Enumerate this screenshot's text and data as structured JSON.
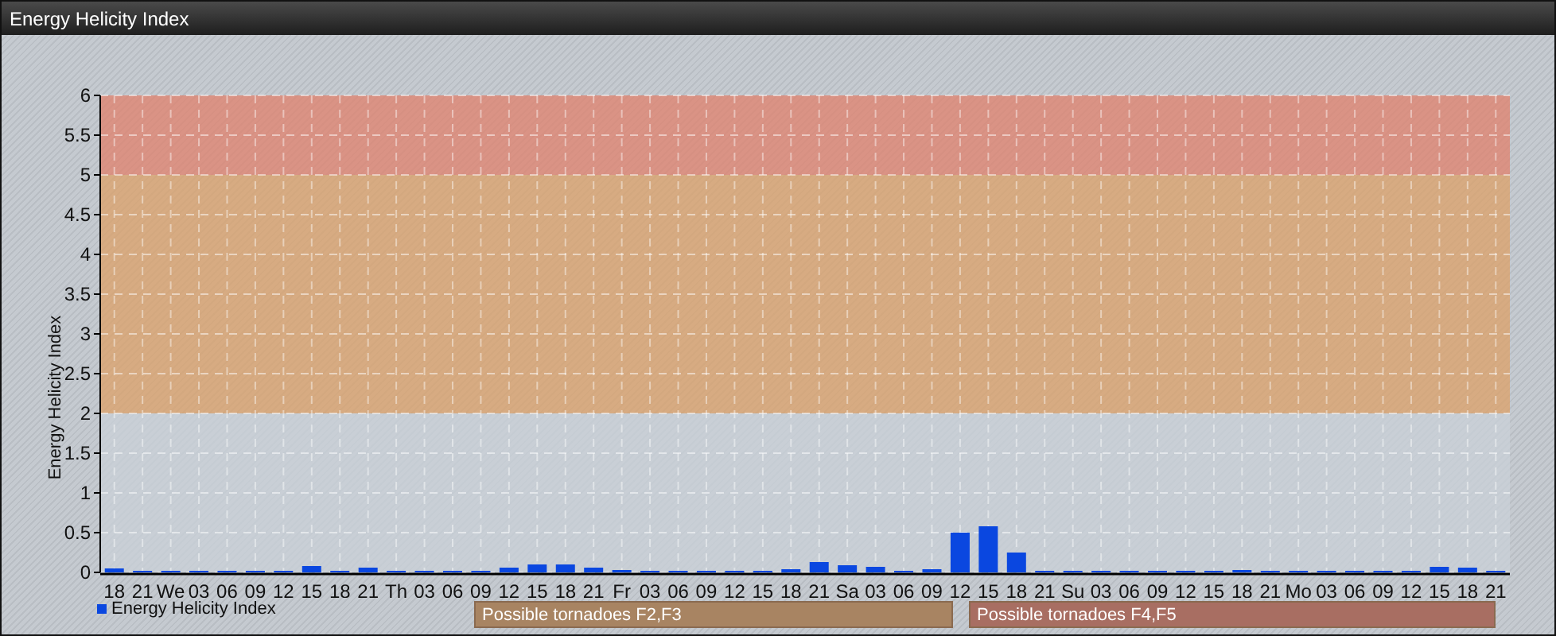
{
  "window": {
    "title": "Energy Helicity Index"
  },
  "chart": {
    "chart_data": {
      "type": "bar",
      "ylabel": "Energy Helicity Index",
      "categories": [
        "18",
        "21",
        "We",
        "03",
        "06",
        "09",
        "12",
        "15",
        "18",
        "21",
        "Th",
        "03",
        "06",
        "09",
        "12",
        "15",
        "18",
        "21",
        "Fr",
        "03",
        "06",
        "09",
        "12",
        "15",
        "18",
        "21",
        "Sa",
        "03",
        "06",
        "09",
        "12",
        "15",
        "18",
        "21",
        "Su",
        "03",
        "06",
        "09",
        "12",
        "15",
        "18",
        "21",
        "Mo",
        "03",
        "06",
        "09",
        "12",
        "15",
        "18",
        "21"
      ],
      "series": [
        {
          "name": "Energy Helicity Index",
          "color": "#0a47e0",
          "values": [
            0.05,
            0.02,
            0.02,
            0.02,
            0.02,
            0.02,
            0.02,
            0.08,
            0.02,
            0.06,
            0.02,
            0.02,
            0.02,
            0.02,
            0.06,
            0.1,
            0.1,
            0.06,
            0.03,
            0.02,
            0.02,
            0.02,
            0.02,
            0.02,
            0.04,
            0.13,
            0.09,
            0.07,
            0.02,
            0.04,
            0.5,
            0.58,
            0.25,
            0.02,
            0.02,
            0.02,
            0.02,
            0.02,
            0.02,
            0.02,
            0.03,
            0.02,
            0.02,
            0.02,
            0.02,
            0.02,
            0.02,
            0.07,
            0.06,
            0.02
          ]
        }
      ],
      "ylim": [
        0,
        6
      ],
      "yticks": [
        0,
        0.5,
        1,
        1.5,
        2,
        2.5,
        3,
        3.5,
        4,
        4.5,
        5,
        5.5,
        6
      ],
      "grid": true,
      "bands": [
        {
          "axis": "y",
          "from": 0,
          "to": 2,
          "color": "#c9d0d8"
        },
        {
          "axis": "y",
          "from": 2,
          "to": 5,
          "color": "#dca068"
        },
        {
          "axis": "y",
          "from": 5,
          "to": 6,
          "color": "#e0806c"
        }
      ]
    },
    "band_labels": [
      {
        "text": "Possible tornadoes F2,F3",
        "color": "#a88462"
      },
      {
        "text": "Possible tornadoes F4,F5",
        "color": "#a86e62"
      }
    ]
  }
}
